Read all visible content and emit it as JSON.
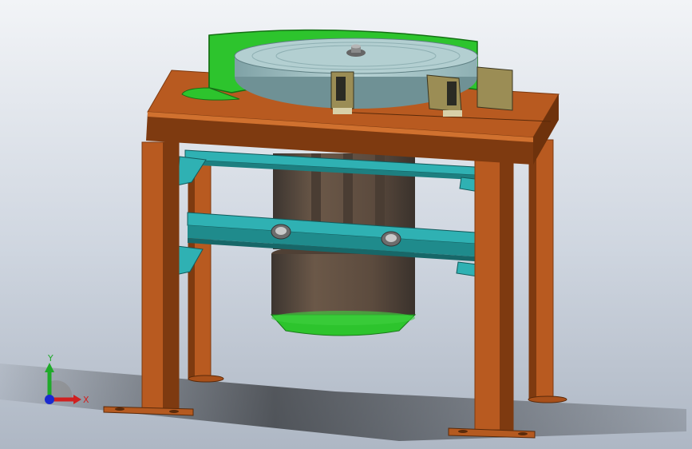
{
  "viewport": {
    "background_top": "#f2f4f7",
    "background_bottom": "#aeb7c4"
  },
  "model": {
    "frame_color": "#b85a20",
    "frame_dark": "#7e3a10",
    "bracket_color": "#2fb1b3",
    "motor_color": "#5b4a3c",
    "guard_color": "#2dc42d",
    "disc_color": "#a9c6c9",
    "sensor_color": "#9b8d55"
  },
  "triad": {
    "x_label": "X",
    "y_label": "Y",
    "x_color": "#d02020",
    "y_color": "#1faa2a",
    "z_color": "#1a2ad0"
  }
}
